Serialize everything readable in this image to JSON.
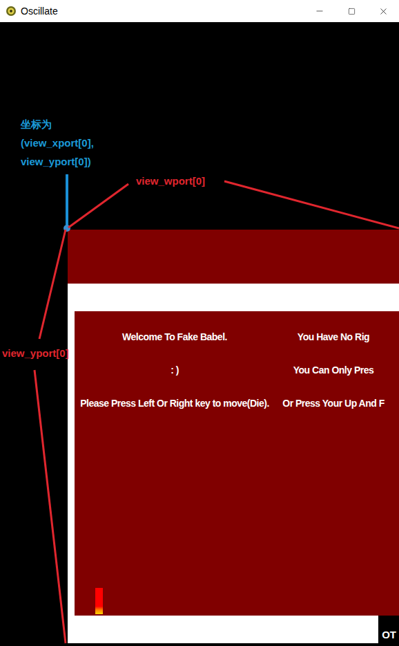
{
  "window": {
    "title": "Oscillate"
  },
  "game": {
    "text_columns": [
      {
        "lines": [
          "Welcome To Fake Babel.",
          ": )",
          "Please Press Left Or Right key to move(Die)."
        ]
      },
      {
        "lines": [
          "You Have No Rig",
          "You Can Only Pres",
          "Or Press Your Up And F"
        ]
      }
    ],
    "corner_text": "OT"
  },
  "annotations": {
    "origin_label": [
      "坐标为",
      "(view_xport[0],",
      "view_yport[0])"
    ],
    "width_label": "view_wport[0]",
    "height_label": "view_yport[0]"
  }
}
